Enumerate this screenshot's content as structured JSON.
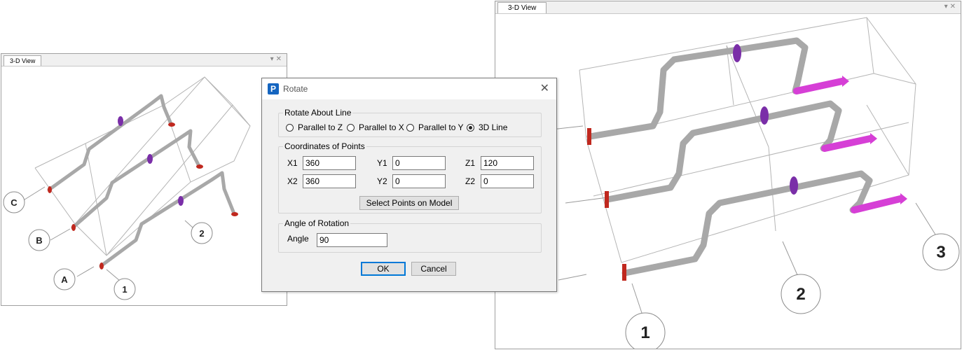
{
  "left_view": {
    "tab_label": "3-D View",
    "grid_labels": [
      "C",
      "B",
      "A",
      "1",
      "2"
    ]
  },
  "right_view": {
    "tab_label": "3-D View",
    "grid_labels": [
      "1",
      "2",
      "3"
    ]
  },
  "window_buttons": {
    "dropdown": "▾",
    "close": "✕"
  },
  "dialog": {
    "title": "Rotate",
    "logo": "P",
    "close_label": "✕",
    "rotate_about_line": {
      "label": "Rotate About Line",
      "options": [
        "Parallel to Z",
        "Parallel to X",
        "Parallel to Y",
        "3D Line"
      ],
      "selected": "3D Line"
    },
    "coordinates": {
      "label": "Coordinates of Points",
      "x1_label": "X1",
      "x1": "360",
      "y1_label": "Y1",
      "y1": "0",
      "z1_label": "Z1",
      "z1": "120",
      "x2_label": "X2",
      "x2": "360",
      "y2_label": "Y2",
      "y2": "0",
      "z2_label": "Z2",
      "z2": "0",
      "select_points_label": "Select Points on Model"
    },
    "angle_of_rotation": {
      "label": "Angle of Rotation",
      "angle_label": "Angle",
      "angle": "90"
    },
    "ok_label": "OK",
    "cancel_label": "Cancel"
  },
  "colors": {
    "pipe": "#a8a8a8",
    "flange_red": "#c0281e",
    "valve_purple": "#7a2ea8",
    "support_magenta": "#d63fd6"
  }
}
